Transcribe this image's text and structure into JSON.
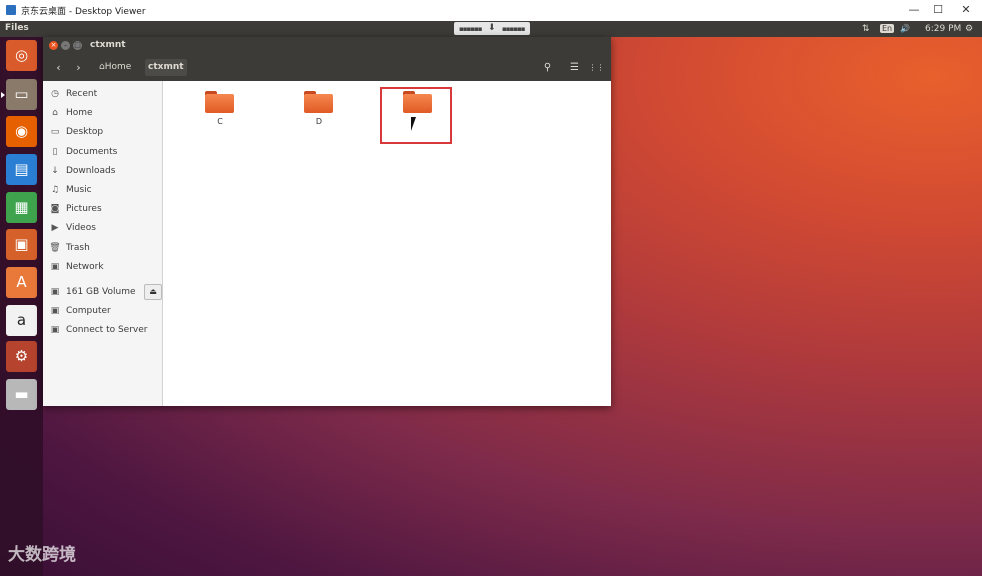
{
  "host_window": {
    "title": "京东云桌面 - Desktop Viewer",
    "controls": [
      "—",
      "☐",
      "✕"
    ]
  },
  "topbar": {
    "app_name": "Files",
    "handle_left": "▪▪▪▪▪▪",
    "handle_mid": "⬇",
    "handle_right": "▪▪▪▪▪▪",
    "network_glyph": "⇅",
    "keyboard_layout": "En",
    "volume_glyph": "🔊",
    "time": "6:29 PM",
    "settings_glyph": "⚙"
  },
  "launcher": {
    "items": [
      {
        "name": "ubuntu-dash-icon",
        "glyph": "◎",
        "bg": "#d95a2b"
      },
      {
        "name": "files-icon",
        "glyph": "▭",
        "bg": "#8a7a6a"
      },
      {
        "name": "firefox-icon",
        "glyph": "◉",
        "bg": "#e66000"
      },
      {
        "name": "writer-icon",
        "glyph": "▤",
        "bg": "#2a7fd4"
      },
      {
        "name": "calc-icon",
        "glyph": "▦",
        "bg": "#3fa34d"
      },
      {
        "name": "impress-icon",
        "glyph": "▣",
        "bg": "#d6602a"
      },
      {
        "name": "software-center-icon",
        "glyph": "A",
        "bg": "#e8793a"
      },
      {
        "name": "amazon-icon",
        "glyph": "a",
        "bg": "#f2f2f2"
      },
      {
        "name": "system-settings-icon",
        "glyph": "⚙",
        "bg": "#b5432d"
      },
      {
        "name": "drive-icon",
        "glyph": "▬",
        "bg": "#b8b8b8"
      }
    ]
  },
  "window": {
    "title": "ctxmnt",
    "nav": {
      "back": "‹",
      "forward": "›"
    },
    "breadcrumbs": {
      "home": "Home",
      "current": "ctxmnt"
    },
    "tools": {
      "search": "⚲",
      "list": "☰",
      "grid": "⋮⋮"
    }
  },
  "sidebar": {
    "places": [
      {
        "icon": "◷",
        "label": "Recent"
      },
      {
        "icon": "⌂",
        "label": "Home"
      },
      {
        "icon": "▭",
        "label": "Desktop"
      },
      {
        "icon": "▯",
        "label": "Documents"
      },
      {
        "icon": "↓",
        "label": "Downloads"
      },
      {
        "icon": "♫",
        "label": "Music"
      },
      {
        "icon": "◙",
        "label": "Pictures"
      },
      {
        "icon": "▶",
        "label": "Videos"
      },
      {
        "icon": "🗑",
        "label": "Trash"
      },
      {
        "icon": "▣",
        "label": "Network"
      }
    ],
    "devices": [
      {
        "icon": "▣",
        "label": "161 GB Volume",
        "eject": "⏏"
      },
      {
        "icon": "▣",
        "label": "Computer"
      },
      {
        "icon": "▣",
        "label": "Connect to Server"
      }
    ]
  },
  "content": {
    "folders": [
      {
        "label": "C"
      },
      {
        "label": "D"
      },
      {
        "label": ""
      }
    ]
  },
  "watermark": "大数跨境"
}
